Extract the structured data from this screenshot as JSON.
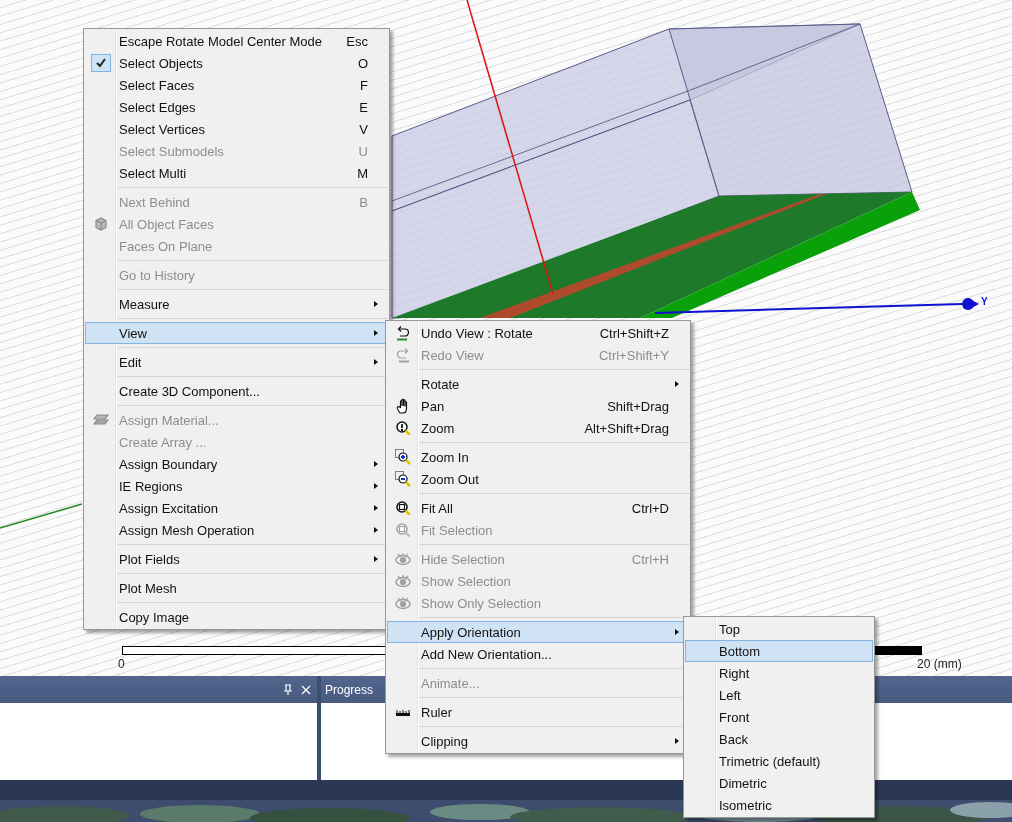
{
  "viewport": {
    "axis_label": "Y",
    "scale_bar": {
      "start": "0",
      "end": "20 (mm)"
    }
  },
  "context_menu": {
    "groups": [
      {
        "items": [
          {
            "label": "Escape Rotate Model Center Mode",
            "shortcut": "Esc",
            "checked": false,
            "disabled": false,
            "selected": false,
            "submenu": false
          },
          {
            "label": "Select Objects",
            "shortcut": "O",
            "checked": true,
            "disabled": false,
            "selected": false,
            "submenu": false
          },
          {
            "label": "Select Faces",
            "shortcut": "F",
            "checked": false,
            "disabled": false,
            "selected": false,
            "submenu": false
          },
          {
            "label": "Select Edges",
            "shortcut": "E",
            "checked": false,
            "disabled": false,
            "selected": false,
            "submenu": false
          },
          {
            "label": "Select Vertices",
            "shortcut": "V",
            "checked": false,
            "disabled": false,
            "selected": false,
            "submenu": false
          },
          {
            "label": "Select Submodels",
            "shortcut": "U",
            "checked": false,
            "disabled": true,
            "selected": false,
            "submenu": false
          },
          {
            "label": "Select Multi",
            "shortcut": "M",
            "checked": false,
            "disabled": false,
            "selected": false,
            "submenu": false
          }
        ]
      },
      {
        "items": [
          {
            "label": "Next Behind",
            "shortcut": "B",
            "checked": false,
            "disabled": true,
            "selected": false,
            "submenu": false
          },
          {
            "label": "All Object Faces",
            "checked": false,
            "disabled": true,
            "selected": false,
            "submenu": false
          },
          {
            "label": "Faces On Plane",
            "checked": false,
            "disabled": true,
            "selected": false,
            "submenu": false
          }
        ]
      },
      {
        "items": [
          {
            "label": "Go to History",
            "checked": false,
            "disabled": true,
            "selected": false,
            "submenu": false
          }
        ]
      },
      {
        "items": [
          {
            "label": "Measure",
            "checked": false,
            "disabled": false,
            "selected": false,
            "submenu": true
          }
        ]
      },
      {
        "items": [
          {
            "label": "View",
            "checked": false,
            "disabled": false,
            "selected": true,
            "submenu": true
          }
        ]
      },
      {
        "items": [
          {
            "label": "Edit",
            "checked": false,
            "disabled": false,
            "selected": false,
            "submenu": true
          }
        ]
      },
      {
        "items": [
          {
            "label": "Create 3D Component...",
            "checked": false,
            "disabled": false,
            "selected": false,
            "submenu": false
          }
        ]
      },
      {
        "items": [
          {
            "label": "Assign Material...",
            "checked": false,
            "disabled": true,
            "selected": false,
            "submenu": false
          },
          {
            "label": "Create Array ...",
            "checked": false,
            "disabled": true,
            "selected": false,
            "submenu": false
          },
          {
            "label": "Assign Boundary",
            "checked": false,
            "disabled": false,
            "selected": false,
            "submenu": true
          },
          {
            "label": "IE Regions",
            "checked": false,
            "disabled": false,
            "selected": false,
            "submenu": true
          },
          {
            "label": "Assign Excitation",
            "checked": false,
            "disabled": false,
            "selected": false,
            "submenu": true
          },
          {
            "label": "Assign Mesh Operation",
            "checked": false,
            "disabled": false,
            "selected": false,
            "submenu": true
          }
        ]
      },
      {
        "items": [
          {
            "label": "Plot Fields",
            "checked": false,
            "disabled": false,
            "selected": false,
            "submenu": true
          }
        ]
      },
      {
        "items": [
          {
            "label": "Plot Mesh",
            "checked": false,
            "disabled": false,
            "selected": false,
            "submenu": false
          }
        ]
      },
      {
        "items": [
          {
            "label": "Copy Image",
            "checked": false,
            "disabled": false,
            "selected": false,
            "submenu": false
          }
        ]
      }
    ]
  },
  "view_submenu": {
    "groups": [
      {
        "items": [
          {
            "label": "Undo View : Rotate",
            "shortcut": "Ctrl+Shift+Z",
            "disabled": false,
            "selected": false,
            "submenu": false
          },
          {
            "label": "Redo View",
            "shortcut": "Ctrl+Shift+Y",
            "disabled": true,
            "selected": false,
            "submenu": false
          }
        ]
      },
      {
        "items": [
          {
            "label": "Rotate",
            "disabled": false,
            "selected": false,
            "submenu": true
          },
          {
            "label": "Pan",
            "shortcut": "Shift+Drag",
            "disabled": false,
            "selected": false,
            "submenu": false
          },
          {
            "label": "Zoom",
            "shortcut": "Alt+Shift+Drag",
            "disabled": false,
            "selected": false,
            "submenu": false
          }
        ]
      },
      {
        "items": [
          {
            "label": "Zoom In",
            "disabled": false,
            "selected": false,
            "submenu": false
          },
          {
            "label": "Zoom Out",
            "disabled": false,
            "selected": false,
            "submenu": false
          }
        ]
      },
      {
        "items": [
          {
            "label": "Fit All",
            "shortcut": "Ctrl+D",
            "disabled": false,
            "selected": false,
            "submenu": false
          },
          {
            "label": "Fit Selection",
            "disabled": true,
            "selected": false,
            "submenu": false
          }
        ]
      },
      {
        "items": [
          {
            "label": "Hide Selection",
            "shortcut": "Ctrl+H",
            "disabled": true,
            "selected": false,
            "submenu": false
          },
          {
            "label": "Show Selection",
            "disabled": true,
            "selected": false,
            "submenu": false
          },
          {
            "label": "Show Only Selection",
            "disabled": true,
            "selected": false,
            "submenu": false
          }
        ]
      },
      {
        "items": [
          {
            "label": "Apply Orientation",
            "disabled": false,
            "selected": true,
            "submenu": true
          },
          {
            "label": "Add New Orientation...",
            "disabled": false,
            "selected": false,
            "submenu": false
          }
        ]
      },
      {
        "items": [
          {
            "label": "Animate...",
            "disabled": true,
            "selected": false,
            "submenu": false
          }
        ]
      },
      {
        "items": [
          {
            "label": "Ruler",
            "disabled": false,
            "selected": false,
            "submenu": false
          }
        ]
      },
      {
        "items": [
          {
            "label": "Clipping",
            "disabled": false,
            "selected": false,
            "submenu": true
          }
        ]
      }
    ]
  },
  "orientation_submenu": {
    "groups": [
      {
        "items": [
          {
            "label": "Top",
            "disabled": false,
            "selected": false,
            "submenu": false
          },
          {
            "label": "Bottom",
            "disabled": false,
            "selected": true,
            "submenu": false
          },
          {
            "label": "Right",
            "disabled": false,
            "selected": false,
            "submenu": false
          },
          {
            "label": "Left",
            "disabled": false,
            "selected": false,
            "submenu": false
          },
          {
            "label": "Front",
            "disabled": false,
            "selected": false,
            "submenu": false
          },
          {
            "label": "Back",
            "disabled": false,
            "selected": false,
            "submenu": false
          },
          {
            "label": "Trimetric (default)",
            "disabled": false,
            "selected": false,
            "submenu": false
          },
          {
            "label": "Dimetric",
            "disabled": false,
            "selected": false,
            "submenu": false
          },
          {
            "label": "Isometric",
            "disabled": false,
            "selected": false,
            "submenu": false
          }
        ]
      }
    ]
  },
  "bottom_panels": {
    "progress_title": "Progress"
  }
}
